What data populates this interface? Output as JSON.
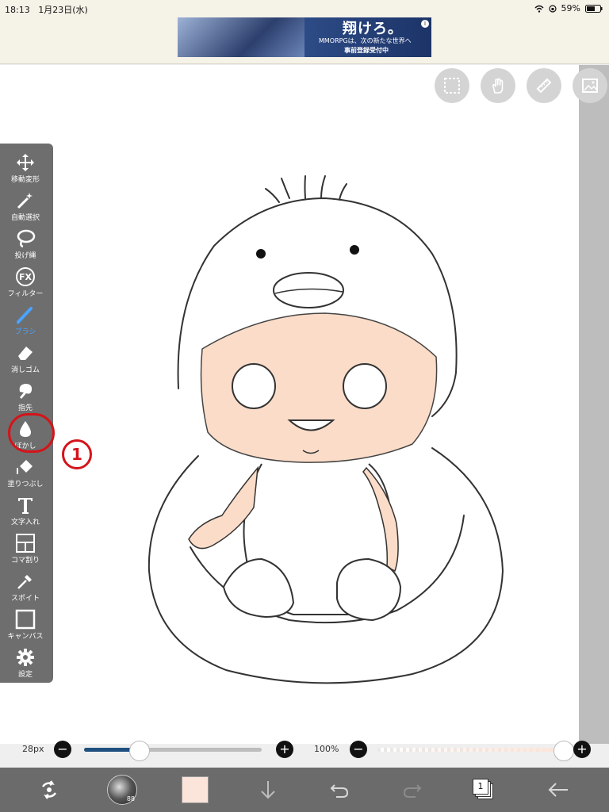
{
  "status_bar": {
    "time": "18:13",
    "date": "1月23日(水)",
    "battery": "59%"
  },
  "ad": {
    "title": "翔けろ。",
    "subtitle": "MMORPGは、次の新たな世界へ",
    "cta": "事前登録受付中"
  },
  "canvas_tools": [
    "selection-icon",
    "hand-icon",
    "ruler-icon",
    "layer-image-icon"
  ],
  "toolbar": {
    "items": [
      {
        "label": "移動変形",
        "icon": "move-icon"
      },
      {
        "label": "自動選択",
        "icon": "magic-wand-icon"
      },
      {
        "label": "投げ縄",
        "icon": "lasso-icon"
      },
      {
        "label": "フィルター",
        "icon": "fx-icon"
      },
      {
        "label": "ブラシ",
        "icon": "brush-icon"
      },
      {
        "label": "消しゴム",
        "icon": "eraser-icon"
      },
      {
        "label": "指先",
        "icon": "smudge-icon"
      },
      {
        "label": "ぼかし",
        "icon": "blur-drop-icon"
      },
      {
        "label": "塗りつぶし",
        "icon": "fill-bucket-icon"
      },
      {
        "label": "文字入れ",
        "icon": "text-icon"
      },
      {
        "label": "コマ割り",
        "icon": "frame-divider-icon"
      },
      {
        "label": "スポイト",
        "icon": "eyedropper-icon"
      },
      {
        "label": "キャンバス",
        "icon": "canvas-icon"
      },
      {
        "label": "設定",
        "icon": "gear-icon"
      }
    ],
    "active": "ブラシ"
  },
  "annotation": {
    "number": "1"
  },
  "brush_size": {
    "label": "28px",
    "fraction": 0.31
  },
  "opacity": {
    "label": "100%",
    "fraction": 1.0
  },
  "bottom_bar": {
    "layers_count": "1",
    "brush_preview_number": "88"
  },
  "colors": {
    "current_color": "#fbe5da",
    "skin": "#fbdcc8",
    "toolbar_bg": "#6e6e6e",
    "active_tool": "#4aa3ff",
    "annotation": "#d4141a"
  }
}
